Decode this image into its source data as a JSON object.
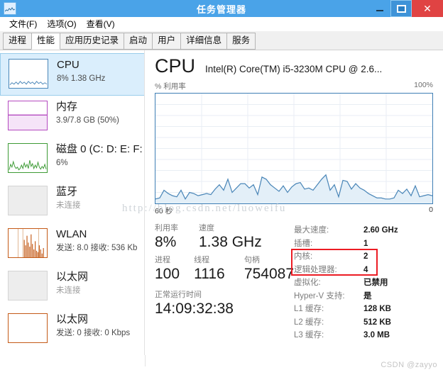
{
  "window": {
    "title": "任务管理器",
    "icon": "task-manager-icon",
    "minimize_label": "─",
    "maximize_label": "❐",
    "close_label": "✕"
  },
  "menu": {
    "items": [
      {
        "label": "文件(F)"
      },
      {
        "label": "选项(O)"
      },
      {
        "label": "查看(V)"
      }
    ]
  },
  "tabs": [
    {
      "label": "进程",
      "selected": false
    },
    {
      "label": "性能",
      "selected": true
    },
    {
      "label": "应用历史记录",
      "selected": false
    },
    {
      "label": "启动",
      "selected": false
    },
    {
      "label": "用户",
      "selected": false
    },
    {
      "label": "详细信息",
      "selected": false
    },
    {
      "label": "服务",
      "selected": false
    }
  ],
  "sidebar": {
    "items": [
      {
        "title": "CPU",
        "sub": "8% 1.38 GHz",
        "selected": true,
        "graph": "line",
        "color": "#4a86b8",
        "dim": false
      },
      {
        "title": "内存",
        "sub": "3.9/7.8 GB (50%)",
        "selected": false,
        "graph": "memory",
        "color": "#b44ac0",
        "dim": false
      },
      {
        "title": "磁盘 0 (C: D: E: F:",
        "sub": "6%",
        "selected": false,
        "graph": "line",
        "color": "#3d9b35",
        "dim": false
      },
      {
        "title": "蓝牙",
        "sub": "未连接",
        "selected": false,
        "graph": "empty",
        "color": "#c8c8c8",
        "dim": true
      },
      {
        "title": "WLAN",
        "sub": "发送: 8.0 接收: 536 Kb",
        "selected": false,
        "graph": "bars",
        "color": "#c45a17",
        "dim": false
      },
      {
        "title": "以太网",
        "sub": "未连接",
        "selected": false,
        "graph": "empty",
        "color": "#c8c8c8",
        "dim": true
      },
      {
        "title": "以太网",
        "sub": "发送: 0 接收: 0 Kbps",
        "selected": false,
        "graph": "flat",
        "color": "#c45a17",
        "dim": false
      }
    ]
  },
  "main": {
    "heading": "CPU",
    "model": "Intel(R) Core(TM) i5-3230M CPU @ 2.6...",
    "axis_label": "% 利用率",
    "axis_max": "100%",
    "time_left": "60 秒",
    "time_right": "0",
    "stats": {
      "utilization_label": "利用率",
      "utilization_value": "8%",
      "speed_label": "速度",
      "speed_value": "1.38 GHz",
      "processes_label": "进程",
      "processes_value": "100",
      "threads_label": "线程",
      "threads_value": "1116",
      "handles_label": "句柄",
      "handles_value": "754087",
      "uptime_label": "正常运行时间",
      "uptime_value": "14:09:32:38"
    },
    "specs": [
      {
        "label": "最大速度:",
        "value": "2.60 GHz"
      },
      {
        "label": "插槽:",
        "value": "1"
      },
      {
        "label": "内核:",
        "value": "2"
      },
      {
        "label": "逻辑处理器:",
        "value": "4"
      },
      {
        "label": "虚拟化:",
        "value": "已禁用"
      },
      {
        "label": "Hyper-V 支持:",
        "value": "是"
      },
      {
        "label": "L1 缓存:",
        "value": "128 KB"
      },
      {
        "label": "L2 缓存:",
        "value": "512 KB"
      },
      {
        "label": "L3 缓存:",
        "value": "3.0 MB"
      }
    ],
    "highlight_color": "#ec1c24"
  },
  "watermarks": {
    "url": "http://blog.csdn.net/luoweifu",
    "csdn": "CSDN @zayyo"
  },
  "chart_data": {
    "type": "line",
    "title": "CPU 利用率",
    "xlabel": "60 秒",
    "ylabel": "% 利用率",
    "ylim": [
      0,
      100
    ],
    "xlim": [
      60,
      0
    ],
    "grid": true,
    "legend": "none",
    "series": [
      {
        "name": "% 利用率",
        "values": [
          4,
          5,
          12,
          9,
          7,
          6,
          12,
          4,
          10,
          9,
          7,
          8,
          9,
          8,
          13,
          17,
          12,
          22,
          10,
          14,
          18,
          18,
          14,
          17,
          8,
          24,
          22,
          17,
          14,
          11,
          16,
          10,
          15,
          18,
          19,
          13,
          14,
          12,
          17,
          22,
          26,
          12,
          17,
          6,
          21,
          20,
          13,
          18,
          14,
          12,
          9,
          7,
          5,
          5,
          4,
          4,
          5,
          12,
          9,
          13,
          7,
          16,
          6,
          7,
          8,
          7
        ]
      }
    ]
  }
}
